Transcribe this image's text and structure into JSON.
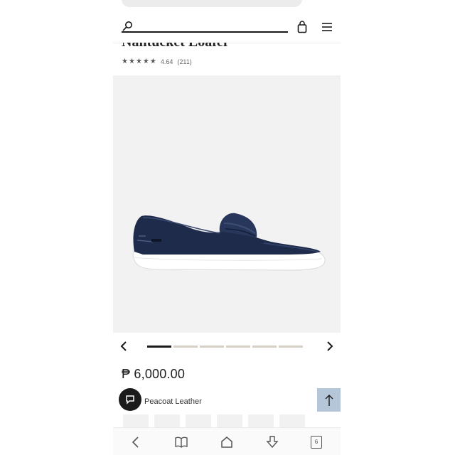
{
  "header": {
    "icons": [
      "search-icon",
      "shopping-bag-icon",
      "menu-icon"
    ]
  },
  "product": {
    "title": "Nantucket Loafer",
    "rating": "4.64",
    "review_count": "(211)",
    "stars": 4.64,
    "price": "₱ 6,000.00",
    "color_label": "Peacoat Leather"
  },
  "carousel": {
    "total_slides": 6,
    "active_slide": 1
  },
  "toolbar": {
    "tab_count": "6"
  },
  "colors": {
    "image_bg": "#f2f2f2",
    "shoe_navy": "#1e2b4a",
    "scroll_top_bg": "#b4c6d8"
  }
}
